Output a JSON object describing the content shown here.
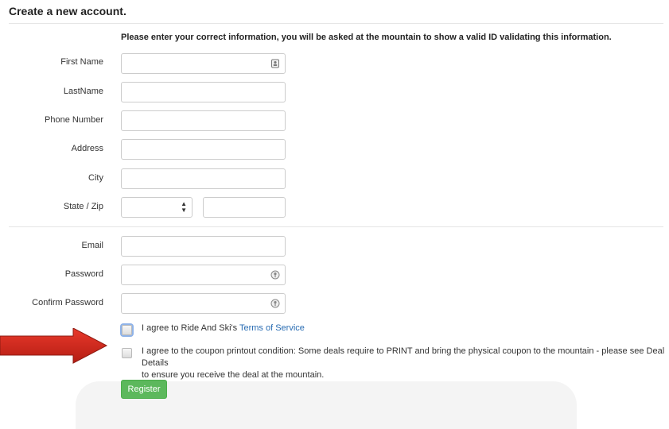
{
  "page": {
    "title": "Create a new account.",
    "intro": "Please enter your correct information, you will be asked at the mountain to show a valid ID validating this information."
  },
  "form": {
    "first_name": {
      "label": "First Name",
      "value": ""
    },
    "last_name": {
      "label": "LastName",
      "value": ""
    },
    "phone": {
      "label": "Phone Number",
      "value": ""
    },
    "address": {
      "label": "Address",
      "value": ""
    },
    "city": {
      "label": "City",
      "value": ""
    },
    "state_zip": {
      "label": "State / Zip",
      "state_value": "",
      "zip_value": ""
    },
    "email": {
      "label": "Email",
      "value": ""
    },
    "password": {
      "label": "Password",
      "value": ""
    },
    "confirm_password": {
      "label": "Confirm Password",
      "value": ""
    }
  },
  "agreements": {
    "terms_prefix": "I agree to Ride And Ski's ",
    "terms_link": "Terms of Service",
    "coupon_line1": "I agree to the coupon printout condition: Some deals require to PRINT and bring the physical coupon to the mountain - please see Deal Details",
    "coupon_line2": "to ensure you receive the deal at the mountain."
  },
  "actions": {
    "register_label": "Register"
  },
  "colors": {
    "arrow": "#d52b1e",
    "button": "#5cb85c",
    "link": "#2a6db3"
  },
  "icons": {
    "contact_card": "contact-card-icon",
    "password_key": "key-icon",
    "select_arrows": "up-down-arrows-icon"
  }
}
